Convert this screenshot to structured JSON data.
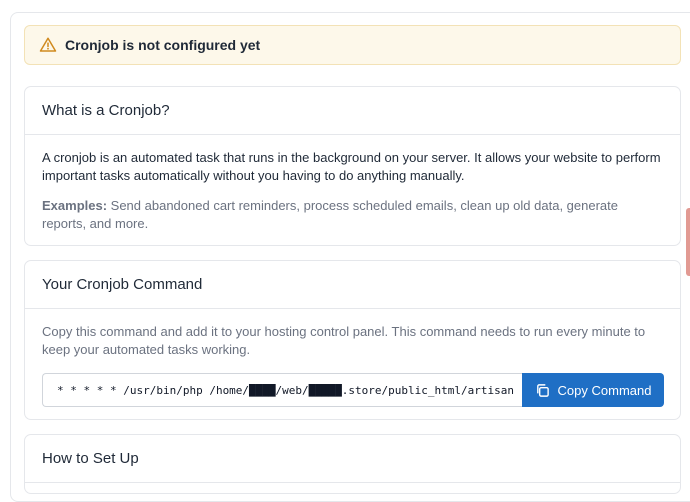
{
  "alert": {
    "text": "Cronjob is not configured yet",
    "icon": "warning-triangle-icon",
    "accent_color": "#d08a1e"
  },
  "what_card": {
    "title": "What is a Cronjob?",
    "description": "A cronjob is an automated task that runs in the background on your server. It allows your website to perform important tasks automatically without you having to do anything manually.",
    "examples_label": "Examples:",
    "examples_text": " Send abandoned cart reminders, process scheduled emails, clean up old data, generate reports, and more."
  },
  "command_card": {
    "title": "Your Cronjob Command",
    "description": "Copy this command and add it to your hosting control panel. This command needs to run every minute to keep your automated tasks working.",
    "command_value": "* * * * * /usr/bin/php /home/████/web/█████.store/public_html/artisan schedule:run",
    "copy_button_label": "Copy Command",
    "button_color": "#1f6fc5"
  },
  "howto_card": {
    "title": "How to Set Up"
  }
}
